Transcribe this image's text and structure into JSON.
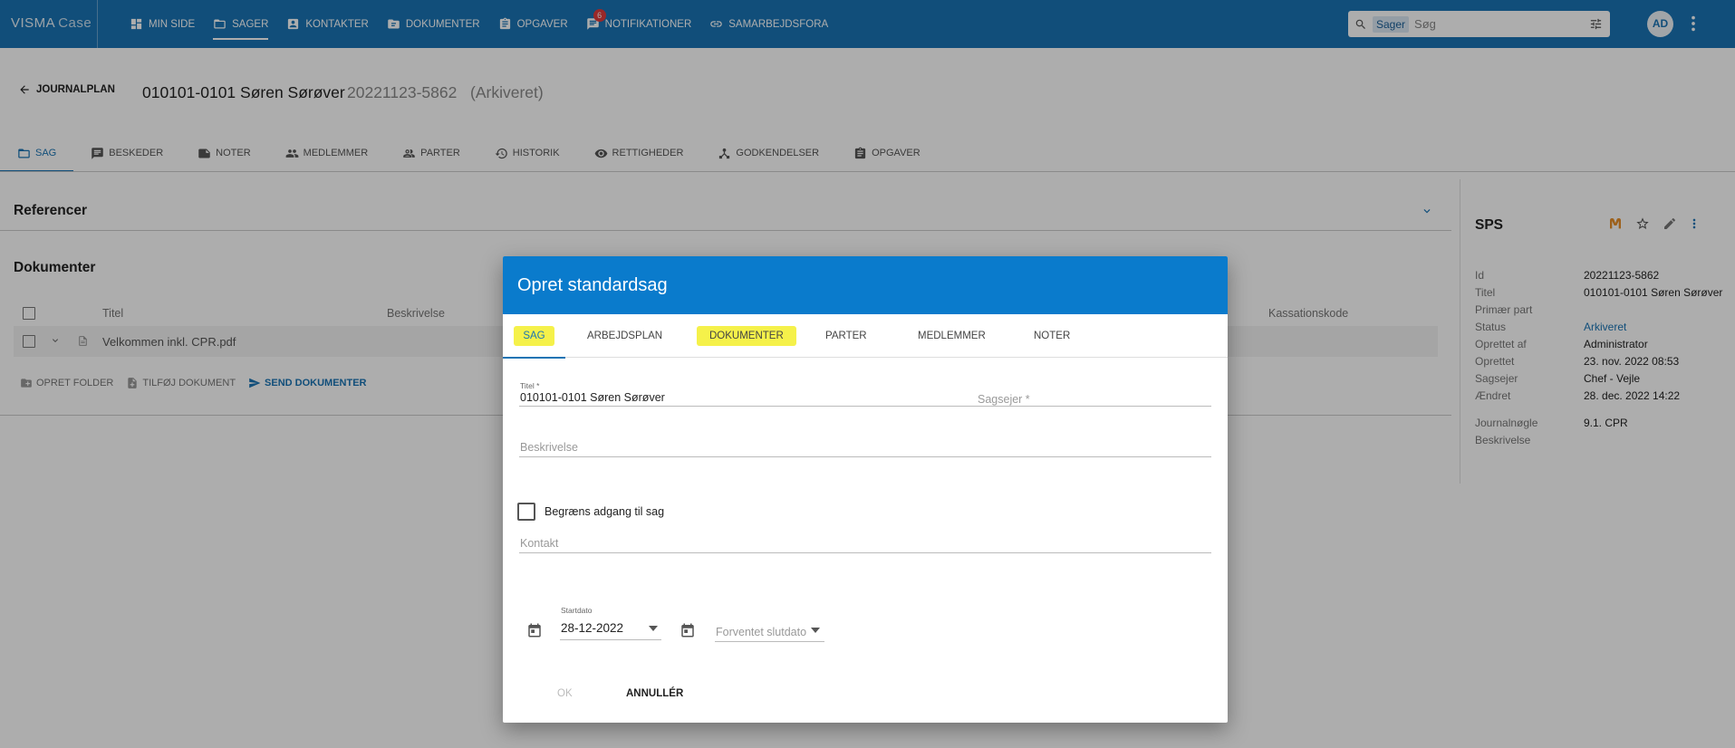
{
  "brand": {
    "name": "VISMA",
    "product": "Case"
  },
  "topnav": [
    {
      "label": "MIN SIDE",
      "icon": "dashboard-icon"
    },
    {
      "label": "SAGER",
      "icon": "folder-icon",
      "active": true
    },
    {
      "label": "KONTAKTER",
      "icon": "contact-icon"
    },
    {
      "label": "DOKUMENTER",
      "icon": "document-folder-icon"
    },
    {
      "label": "OPGAVER",
      "icon": "clipboard-icon"
    },
    {
      "label": "NOTIFIKATIONER",
      "icon": "chat-icon",
      "badge": "6"
    },
    {
      "label": "SAMARBEJDSFORA",
      "icon": "link-icon"
    }
  ],
  "search": {
    "scope": "Sager",
    "placeholder": "Søg"
  },
  "user": {
    "initials": "AD"
  },
  "header": {
    "back_label": "JOURNALPLAN",
    "title": "010101-0101 Søren Sørøver",
    "case_number": "20221123-5862",
    "status": "(Arkiveret)"
  },
  "page_tabs": [
    {
      "label": "SAG",
      "active": true
    },
    {
      "label": "BESKEDER"
    },
    {
      "label": "NOTER"
    },
    {
      "label": "MEDLEMMER"
    },
    {
      "label": "PARTER"
    },
    {
      "label": "HISTORIK"
    },
    {
      "label": "RETTIGHEDER"
    },
    {
      "label": "GODKENDELSER"
    },
    {
      "label": "OPGAVER"
    }
  ],
  "references": {
    "title": "Referencer"
  },
  "documents": {
    "title": "Dokumenter",
    "columns": [
      "Titel",
      "Beskrivelse",
      "Kassationskode"
    ],
    "rows": [
      {
        "title": "Velkommen inkl. CPR.pdf"
      }
    ],
    "actions": {
      "create_folder": "OPRET FOLDER",
      "add_document": "TILFØJ DOKUMENT",
      "send_documents": "SEND DOKUMENTER"
    }
  },
  "info": {
    "title": "SPS",
    "rows": [
      {
        "key": "Id",
        "value": "20221123-5862"
      },
      {
        "key": "Titel",
        "value": "010101-0101 Søren Sørøver"
      },
      {
        "key": "Primær part",
        "value": ""
      },
      {
        "key": "Status",
        "value": "Arkiveret"
      },
      {
        "key": "Oprettet af",
        "value": "Administrator"
      },
      {
        "key": "Oprettet",
        "value": "23. nov. 2022 08:53"
      },
      {
        "key": "Sagsejer",
        "value": "Chef - Vejle"
      },
      {
        "key": "Ændret",
        "value": "28. dec. 2022 14:22"
      }
    ],
    "rows2": [
      {
        "key": "Journalnøgle",
        "value": "9.1. CPR"
      },
      {
        "key": "Beskrivelse",
        "value": ""
      }
    ]
  },
  "modal": {
    "title": "Opret standardsag",
    "tabs": [
      {
        "label": "SAG",
        "active": true,
        "highlighted": true
      },
      {
        "label": "ARBEJDSPLAN"
      },
      {
        "label": "DOKUMENTER",
        "highlighted": true
      },
      {
        "label": "PARTER"
      },
      {
        "label": "MEDLEMMER"
      },
      {
        "label": "NOTER"
      }
    ],
    "titel_label": "Titel *",
    "titel_value": "010101-0101 Søren Sørøver",
    "sagsejer_placeholder": "Sagsejer *",
    "beskrivelse_placeholder": "Beskrivelse",
    "restrict_label": "Begræns adgang til sag",
    "kontakt_placeholder": "Kontakt",
    "start_label": "Startdato",
    "start_value": "28-12-2022",
    "end_placeholder": "Forventet slutdato",
    "ok_label": "OK",
    "cancel_label": "ANNULLÉR"
  },
  "colors": {
    "topbar": "#1a74b4",
    "modal_header": "#0a7bcc",
    "highlight": "#f5f14a",
    "badge": "#e23b3b"
  }
}
